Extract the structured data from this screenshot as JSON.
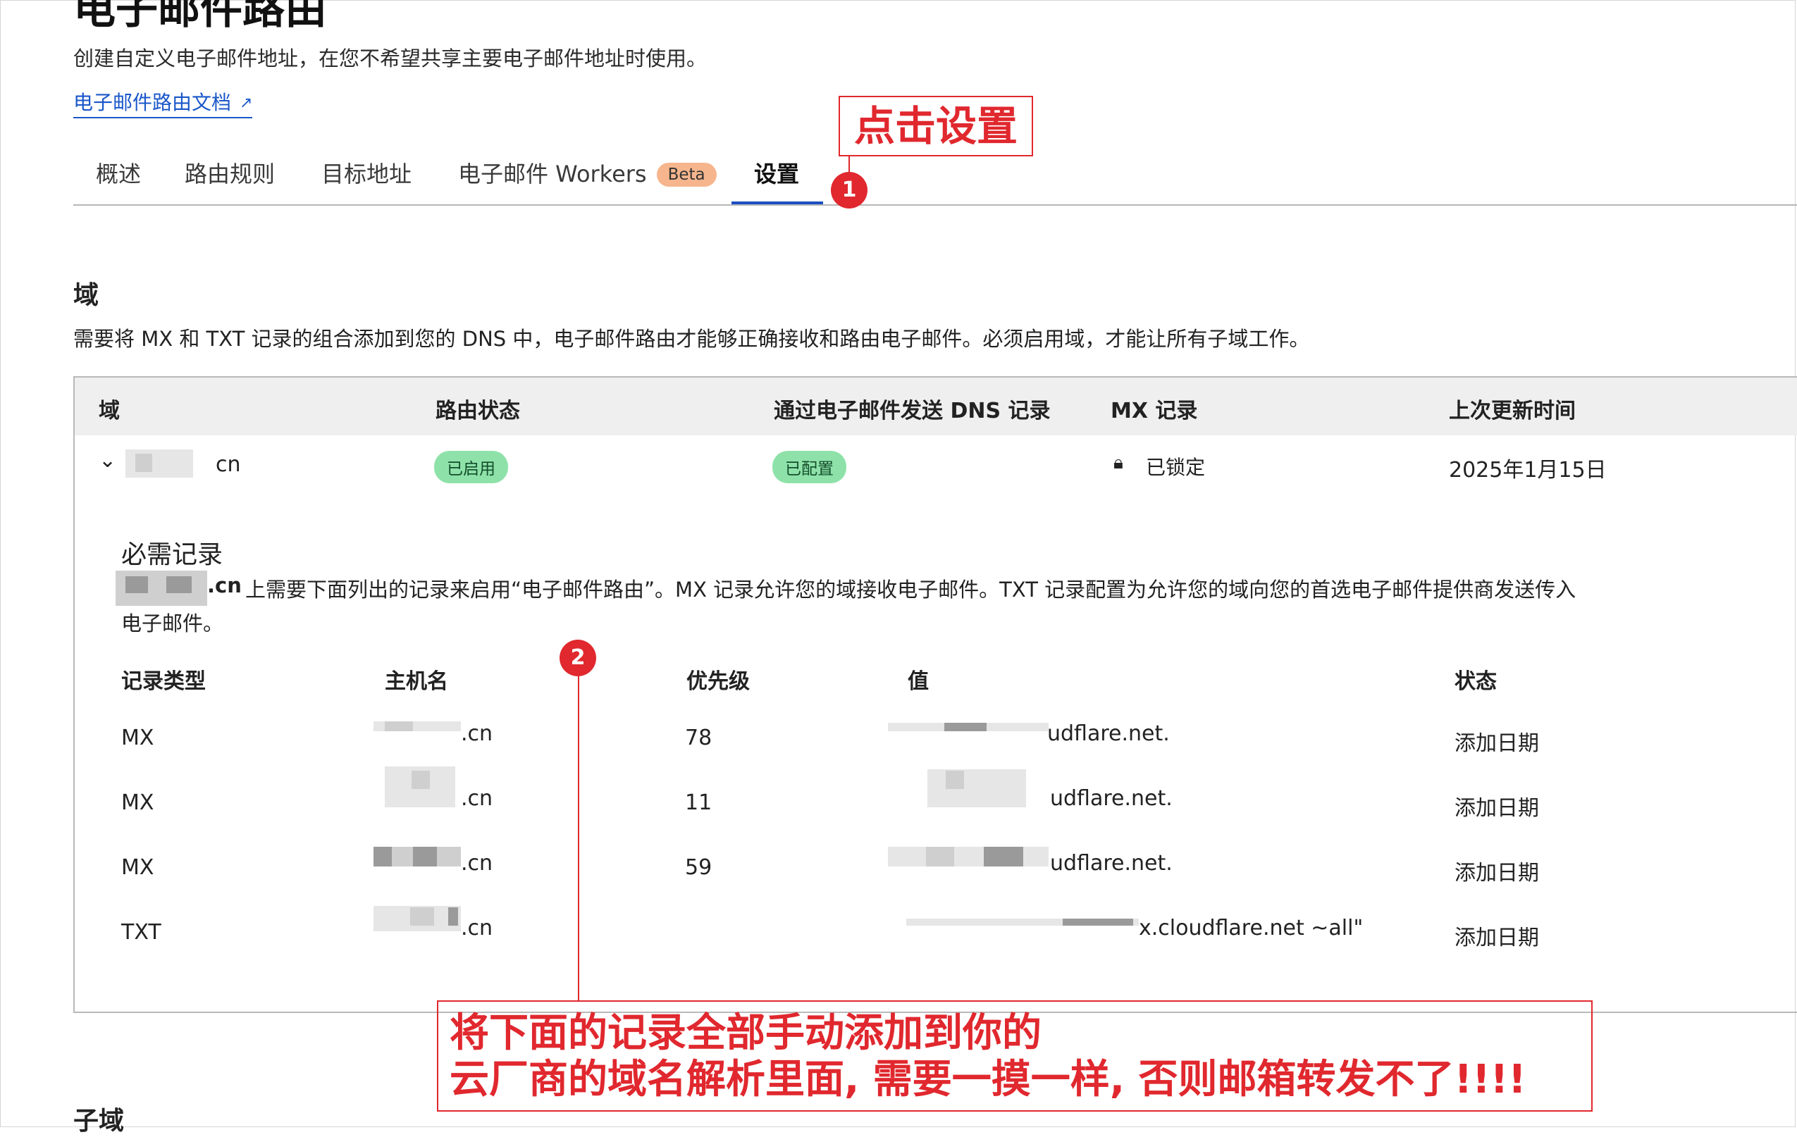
{
  "header": {
    "title": "电子邮件路由",
    "subtitle": "创建自定义电子邮件地址，在您不希望共享主要电子邮件地址时使用。",
    "doc_link": "电子邮件路由文档",
    "doc_link_icon": "external-link-icon"
  },
  "tabs": [
    {
      "label": "概述"
    },
    {
      "label": "路由规则"
    },
    {
      "label": "目标地址"
    },
    {
      "label": "电子邮件 Workers",
      "badge": "Beta"
    },
    {
      "label": "设置",
      "active": true
    }
  ],
  "annotations": {
    "step1_text": "点击设置",
    "step1_badge": "1",
    "step2_badge": "2",
    "step2_line1": "将下面的记录全部手动添加到你的",
    "step2_line2": "云厂商的域名解析里面, 需要一摸一样, 否则邮箱转发不了!!!!",
    "color": "#e0282e"
  },
  "domain_section": {
    "title": "域",
    "description": "需要将 MX 和 TXT 记录的组合添加到您的 DNS 中，电子邮件路由才能够正确接收和路由电子邮件。必须启用域，才能让所有子域工作。",
    "columns": [
      "域",
      "路由状态",
      "通过电子邮件发送 DNS 记录",
      "MX 记录",
      "上次更新时间"
    ],
    "row": {
      "domain_suffix": "cn",
      "routing_status": "已启用",
      "dns_records_status": "已配置",
      "mx_status": "已锁定",
      "mx_icon": "lock-icon",
      "updated": "2025年1月15日",
      "expand_icon": "chevron-down-icon"
    }
  },
  "required_records": {
    "title": "必需记录",
    "desc_domain_suffix": ".cn",
    "desc_text": " 上需要下面列出的记录来启用“电子邮件路由”。MX 记录允许您的域接收电子邮件。TXT 记录配置为允许您的域向您的首选电子邮件提供商发送传入",
    "desc_text_2": "电子邮件。",
    "columns": [
      "记录类型",
      "主机名",
      "优先级",
      "值",
      "状态"
    ],
    "rows": [
      {
        "type": "MX",
        "host": ".cn",
        "priority": "78",
        "value": "udflare.net.",
        "status": "添加日期"
      },
      {
        "type": "MX",
        "host": ".cn",
        "priority": "11",
        "value": "udflare.net.",
        "status": "添加日期"
      },
      {
        "type": "MX",
        "host": ".cn",
        "priority": "59",
        "value": "udflare.net.",
        "status": "添加日期"
      },
      {
        "type": "TXT",
        "host": ".cn",
        "priority": "",
        "value": "x.cloudflare.net ~all\"",
        "status": "添加日期"
      }
    ]
  },
  "subdomain_section": {
    "title": "子域"
  },
  "colors": {
    "accent": "#1d4fc4",
    "link": "#1a57c9",
    "badge_green": "#8ee2a9",
    "beta_orange": "#f6b58c"
  }
}
